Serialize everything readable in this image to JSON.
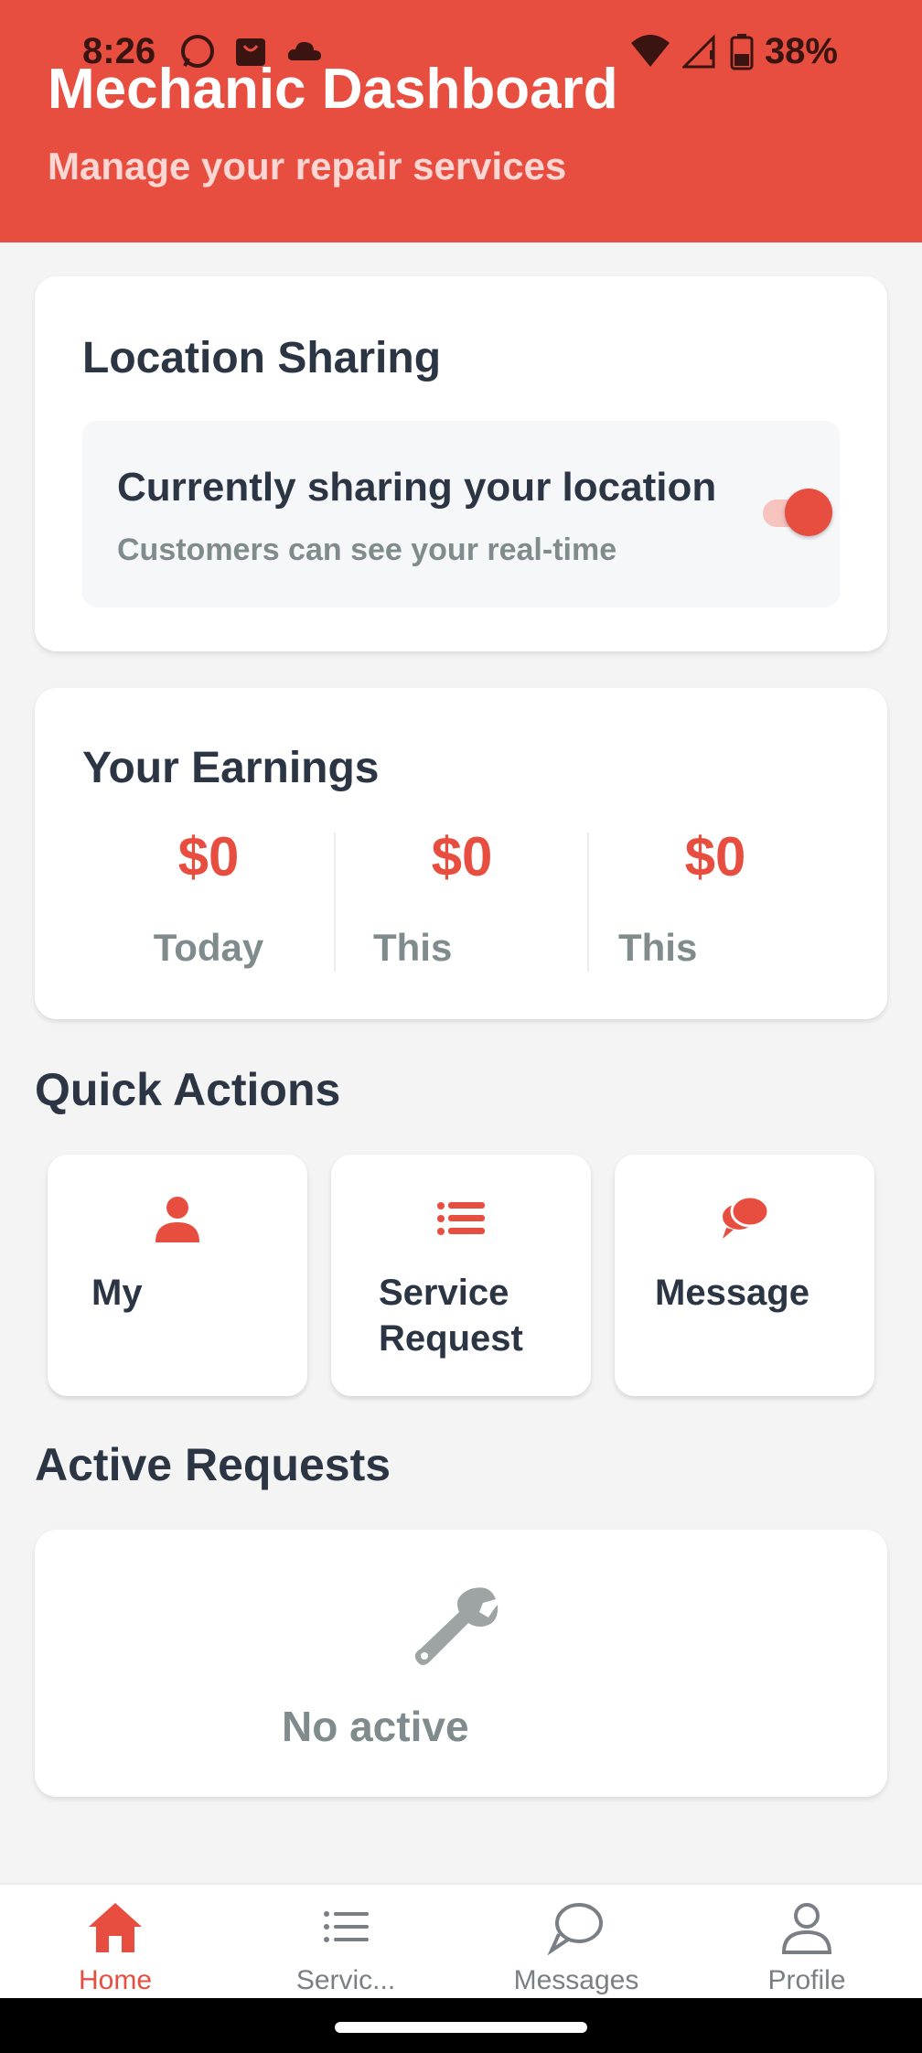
{
  "status_bar": {
    "time": "8:26",
    "battery": "38%"
  },
  "header": {
    "title": "Mechanic Dashboard",
    "subtitle": "Manage your repair services",
    "color": "#e84e40"
  },
  "location": {
    "title": "Location Sharing",
    "status": "Currently sharing your location",
    "description": "Customers can see your real-time",
    "sharing_enabled": true
  },
  "earnings": {
    "title": "Your Earnings",
    "items": [
      {
        "value": "$0",
        "label": "Today"
      },
      {
        "value": "$0",
        "label": "This"
      },
      {
        "value": "$0",
        "label": "This"
      }
    ]
  },
  "quick_actions": {
    "title": "Quick Actions",
    "items": [
      {
        "label": "My",
        "icon": "user-icon"
      },
      {
        "label": "Service Request",
        "icon": "list-icon"
      },
      {
        "label": "Message",
        "icon": "chat-icon"
      }
    ]
  },
  "active_requests": {
    "title": "Active Requests",
    "empty_text": "No active",
    "icon": "wrench-icon"
  },
  "bottom_nav": {
    "items": [
      {
        "label": "Home",
        "icon": "home-icon",
        "active": true
      },
      {
        "label": "Servic...",
        "icon": "list-icon",
        "active": false
      },
      {
        "label": "Messages",
        "icon": "chat-bubble-icon",
        "active": false
      },
      {
        "label": "Profile",
        "icon": "profile-icon",
        "active": false
      }
    ]
  }
}
